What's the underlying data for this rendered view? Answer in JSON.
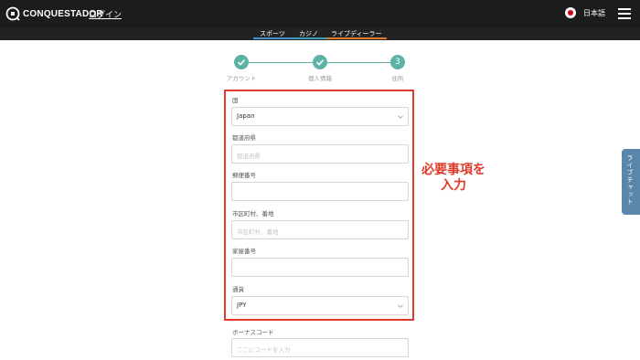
{
  "header": {
    "logo_text": "CONQUESTADOR",
    "login_label": "ログイン",
    "language_label": "日本語"
  },
  "subnav": {
    "items": [
      {
        "label": "スポーツ",
        "accent": "#4a90c8"
      },
      {
        "label": "カジノ",
        "accent": "#3f9fb8"
      },
      {
        "label": "ライブディーラー",
        "accent": "#e07a2e"
      }
    ]
  },
  "steps": [
    {
      "label": "アカウント",
      "state": "done",
      "icon": "check-icon"
    },
    {
      "label": "個人情報",
      "state": "done",
      "icon": "check-icon"
    },
    {
      "label": "住所",
      "state": "current",
      "number": "3"
    }
  ],
  "form": {
    "country": {
      "label": "国",
      "value": "Japan"
    },
    "prefecture": {
      "label": "都道府県",
      "placeholder": "都道府県"
    },
    "postal_code": {
      "label": "郵便番号",
      "placeholder": ""
    },
    "city_address": {
      "label": "市区町村、番地",
      "placeholder": "市区町村、番地"
    },
    "house_number": {
      "label": "家屋番号",
      "placeholder": ""
    },
    "currency": {
      "label": "通貨",
      "value": "JPY"
    },
    "bonus_code": {
      "label": "ボーナスコード",
      "placeholder": "ここにコードを入力"
    }
  },
  "annotation": {
    "line1": "必要事項を",
    "line2": "入力"
  },
  "live_chat": {
    "label": "ライブチャット"
  },
  "colors": {
    "accent": "#5fb3a5",
    "highlight": "#e23a2a",
    "chat": "#5a86ab"
  }
}
